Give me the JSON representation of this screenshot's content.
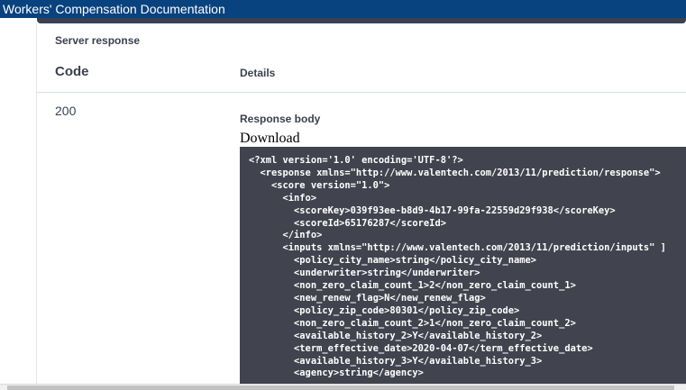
{
  "window": {
    "title": "Workers' Compensation Documentation"
  },
  "response": {
    "section_label": "Server response",
    "code_header": "Code",
    "details_header": "Details",
    "status_code": "200",
    "body_label": "Response body",
    "download_label": "Download",
    "body_lines": [
      "<?xml version='1.0' encoding='UTF-8'?>",
      "  <response xmlns=\"http://www.valentech.com/2013/11/prediction/response\">",
      "    <score version=\"1.0\">",
      "      <info>",
      "        <scoreKey>039f93ee-b8d9-4b17-99fa-22559d29f938</scoreKey>",
      "        <scoreId>65176287</scoreId>",
      "      </info>",
      "      <inputs xmlns=\"http://www.valentech.com/2013/11/prediction/inputs\" ]",
      "        <policy_city_name>string</policy_city_name>",
      "        <underwriter>string</underwriter>",
      "        <non_zero_claim_count_1>2</non_zero_claim_count_1>",
      "        <new_renew_flag>N</new_renew_flag>",
      "        <policy_zip_code>80301</policy_zip_code>",
      "        <non_zero_claim_count_2>1</non_zero_claim_count_2>",
      "        <available_history_2>Y</available_history_2>",
      "        <term_effective_date>2020-04-07</term_effective_date>",
      "        <available_history_3>Y</available_history_3>",
      "        <agency>string</agency>"
    ]
  }
}
